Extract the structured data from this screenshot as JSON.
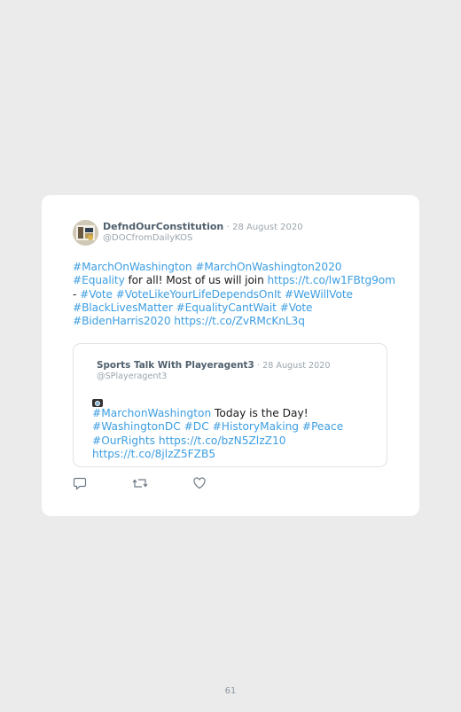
{
  "tweet": {
    "author_name": "DefndOurConstitution",
    "date": "· 28 August 2020",
    "handle": "@DOCfromDailyKOS",
    "lines": [
      [
        {
          "t": "#MarchOnWashington #MarchOnWashington2020",
          "link": true
        }
      ],
      [
        {
          "t": "#Equality",
          "link": true
        },
        {
          "t": " for all! Most of us will join ",
          "link": false
        },
        {
          "t": "https://t.co/lw1FBtg9om",
          "link": true
        }
      ],
      [
        {
          "t": "- ",
          "link": false
        },
        {
          "t": "#Vote #VoteLikeYourLifeDependsOnIt #WeWillVote",
          "link": true
        }
      ],
      [
        {
          "t": "#BlackLivesMatter #EqualityCantWait #Vote",
          "link": true
        }
      ],
      [
        {
          "t": "#BidenHarris2020 https://t.co/ZvRMcKnL3q",
          "link": true
        }
      ]
    ]
  },
  "quoted": {
    "author_name": "Sports Talk With Playeragent3",
    "date": "· 28 August 2020",
    "handle": "@SPlayeragent3",
    "lines": [
      [
        {
          "t": "#MarchonWashington",
          "link": true
        },
        {
          "t": " Today is the Day!",
          "link": false
        }
      ],
      [
        {
          "t": "#WashingtonDC #DC #HistoryMaking #Peace",
          "link": true
        }
      ],
      [
        {
          "t": "#OurRights https://t.co/bzN5ZlzZ10",
          "link": true
        }
      ],
      [
        {
          "t": "https://t.co/8jlzZ5FZB5",
          "link": true
        }
      ]
    ]
  },
  "actions": [
    "reply-icon",
    "retweet-icon",
    "like-icon"
  ],
  "page_number": "61",
  "colors": {
    "link": "#3d9ee2",
    "background": "#ebebeb",
    "card": "#ffffff"
  }
}
